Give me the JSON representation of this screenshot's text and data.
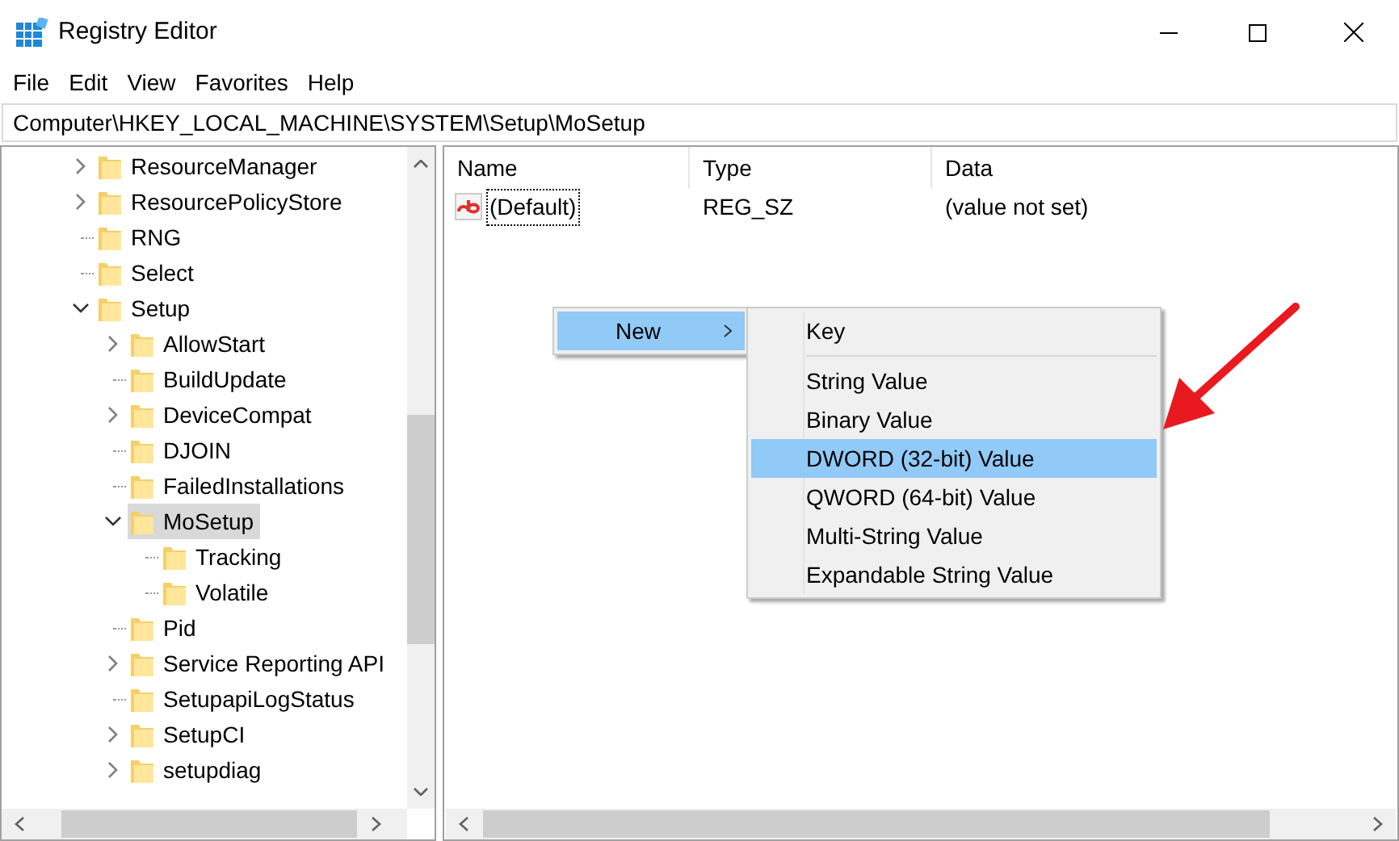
{
  "window": {
    "title": "Registry Editor"
  },
  "menu": [
    "File",
    "Edit",
    "View",
    "Favorites",
    "Help"
  ],
  "address": "Computer\\HKEY_LOCAL_MACHINE\\SYSTEM\\Setup\\MoSetup",
  "tree": [
    {
      "name": "ResourceManager",
      "kind": "collapsed",
      "selected": false
    },
    {
      "name": "ResourcePolicyStore",
      "kind": "collapsed",
      "selected": false
    },
    {
      "name": "RNG",
      "kind": "none",
      "selected": false
    },
    {
      "name": "Select",
      "kind": "none",
      "selected": false
    },
    {
      "name": "Setup",
      "kind": "expanded",
      "selected": false,
      "children": [
        {
          "name": "AllowStart",
          "kind": "collapsed",
          "selected": false
        },
        {
          "name": "BuildUpdate",
          "kind": "none",
          "selected": false
        },
        {
          "name": "DeviceCompat",
          "kind": "collapsed",
          "selected": false
        },
        {
          "name": "DJOIN",
          "kind": "none",
          "selected": false
        },
        {
          "name": "FailedInstallations",
          "kind": "none",
          "selected": false
        },
        {
          "name": "MoSetup",
          "kind": "expanded",
          "selected": true,
          "children": [
            {
              "name": "Tracking",
              "kind": "none",
              "selected": false
            },
            {
              "name": "Volatile",
              "kind": "none",
              "selected": false
            }
          ]
        },
        {
          "name": "Pid",
          "kind": "none",
          "selected": false
        },
        {
          "name": "Service Reporting API",
          "kind": "collapsed",
          "selected": false
        },
        {
          "name": "SetupapiLogStatus",
          "kind": "none",
          "selected": false
        },
        {
          "name": "SetupCI",
          "kind": "collapsed",
          "selected": false
        },
        {
          "name": "setupdiag",
          "kind": "collapsed",
          "selected": false
        }
      ]
    }
  ],
  "columns": [
    "Name",
    "Type",
    "Data"
  ],
  "values": [
    {
      "name": "(Default)",
      "type": "REG_SZ",
      "data": "(value not set)"
    }
  ],
  "context_menu": {
    "items": [
      {
        "label": "New",
        "selected": true
      }
    ]
  },
  "submenu": {
    "items": [
      {
        "label": "Key",
        "selected": false,
        "separator_after": true
      },
      {
        "label": "String Value",
        "selected": false,
        "separator_after": false
      },
      {
        "label": "Binary Value",
        "selected": false,
        "separator_after": false
      },
      {
        "label": "DWORD (32-bit) Value",
        "selected": true,
        "separator_after": false
      },
      {
        "label": "QWORD (64-bit) Value",
        "selected": false,
        "separator_after": false
      },
      {
        "label": "Multi-String Value",
        "selected": false,
        "separator_after": false
      },
      {
        "label": "Expandable String Value",
        "selected": false,
        "separator_after": false
      }
    ]
  }
}
